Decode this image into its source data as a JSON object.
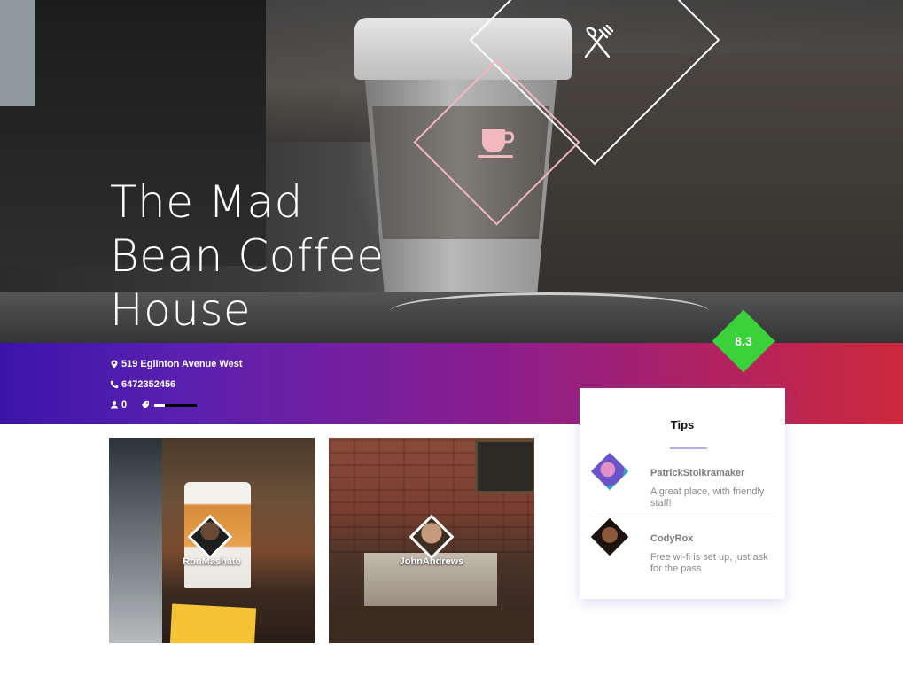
{
  "venue": {
    "name": "The Mad Bean Coffee House",
    "address": "519 Eglinton Avenue West",
    "phone": "6472352456",
    "checkins": "0",
    "score": "8.3",
    "category_icon": "coffee-cup-icon",
    "type_icon": "fork-knife-icon"
  },
  "photos": [
    {
      "user": "RonMashate"
    },
    {
      "user": "JohnAndrews"
    }
  ],
  "tips": {
    "title": "Tips",
    "items": [
      {
        "user": "PatrickStolkramaker",
        "text": "A great place, with friendly staff!"
      },
      {
        "user": "CodyRox",
        "text": "Free wi-fi is set up, just ask for the pass"
      }
    ]
  },
  "colors": {
    "band_start": "#3b15a8",
    "band_end": "#cc2a3c",
    "score_badge": "#3ad13a",
    "diamond_outline_pink": "#f2b8c0",
    "tips_underline": "#b8a8ee"
  },
  "icons": [
    "location-pin-icon",
    "phone-icon",
    "person-icon",
    "tag-icon"
  ]
}
